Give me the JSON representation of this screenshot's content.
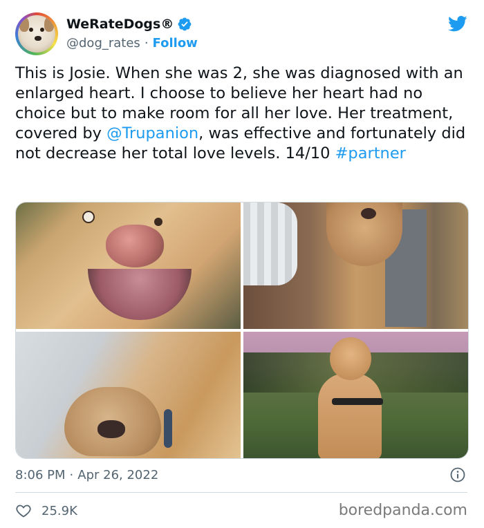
{
  "tweet": {
    "author": {
      "display_name": "WeRateDogs®",
      "handle": "@dog_rates",
      "separator": "·",
      "follow_label": "Follow",
      "verified_icon": "verified-badge-icon",
      "avatar_icon": "dog-avatar"
    },
    "brand_icon": "twitter-bird-icon",
    "text": {
      "part1": "This is Josie. When she was 2, she was diagnosed with an enlarged heart. I choose to believe her heart had no choice but to make room for all her love. Her treatment, covered by ",
      "mention": "@Trupanion",
      "part2": ", was effective and fortunately did not decrease her total love levels. 14/10 ",
      "hashtag": "#partner"
    },
    "media": {
      "count": 4,
      "photos": [
        "dog-photo-1",
        "dog-photo-2",
        "dog-photo-3",
        "dog-photo-4"
      ]
    },
    "timestamp": {
      "time": "8:06 PM",
      "separator": "·",
      "date": "Apr 26, 2022"
    },
    "likes": "25.9K",
    "info_icon": "info-icon",
    "heart_icon": "heart-icon"
  },
  "watermark": "boredpanda.com",
  "colors": {
    "accent": "#1d9bf0",
    "text": "#0f1419",
    "muted": "#536471",
    "border": "#cfd9de"
  }
}
